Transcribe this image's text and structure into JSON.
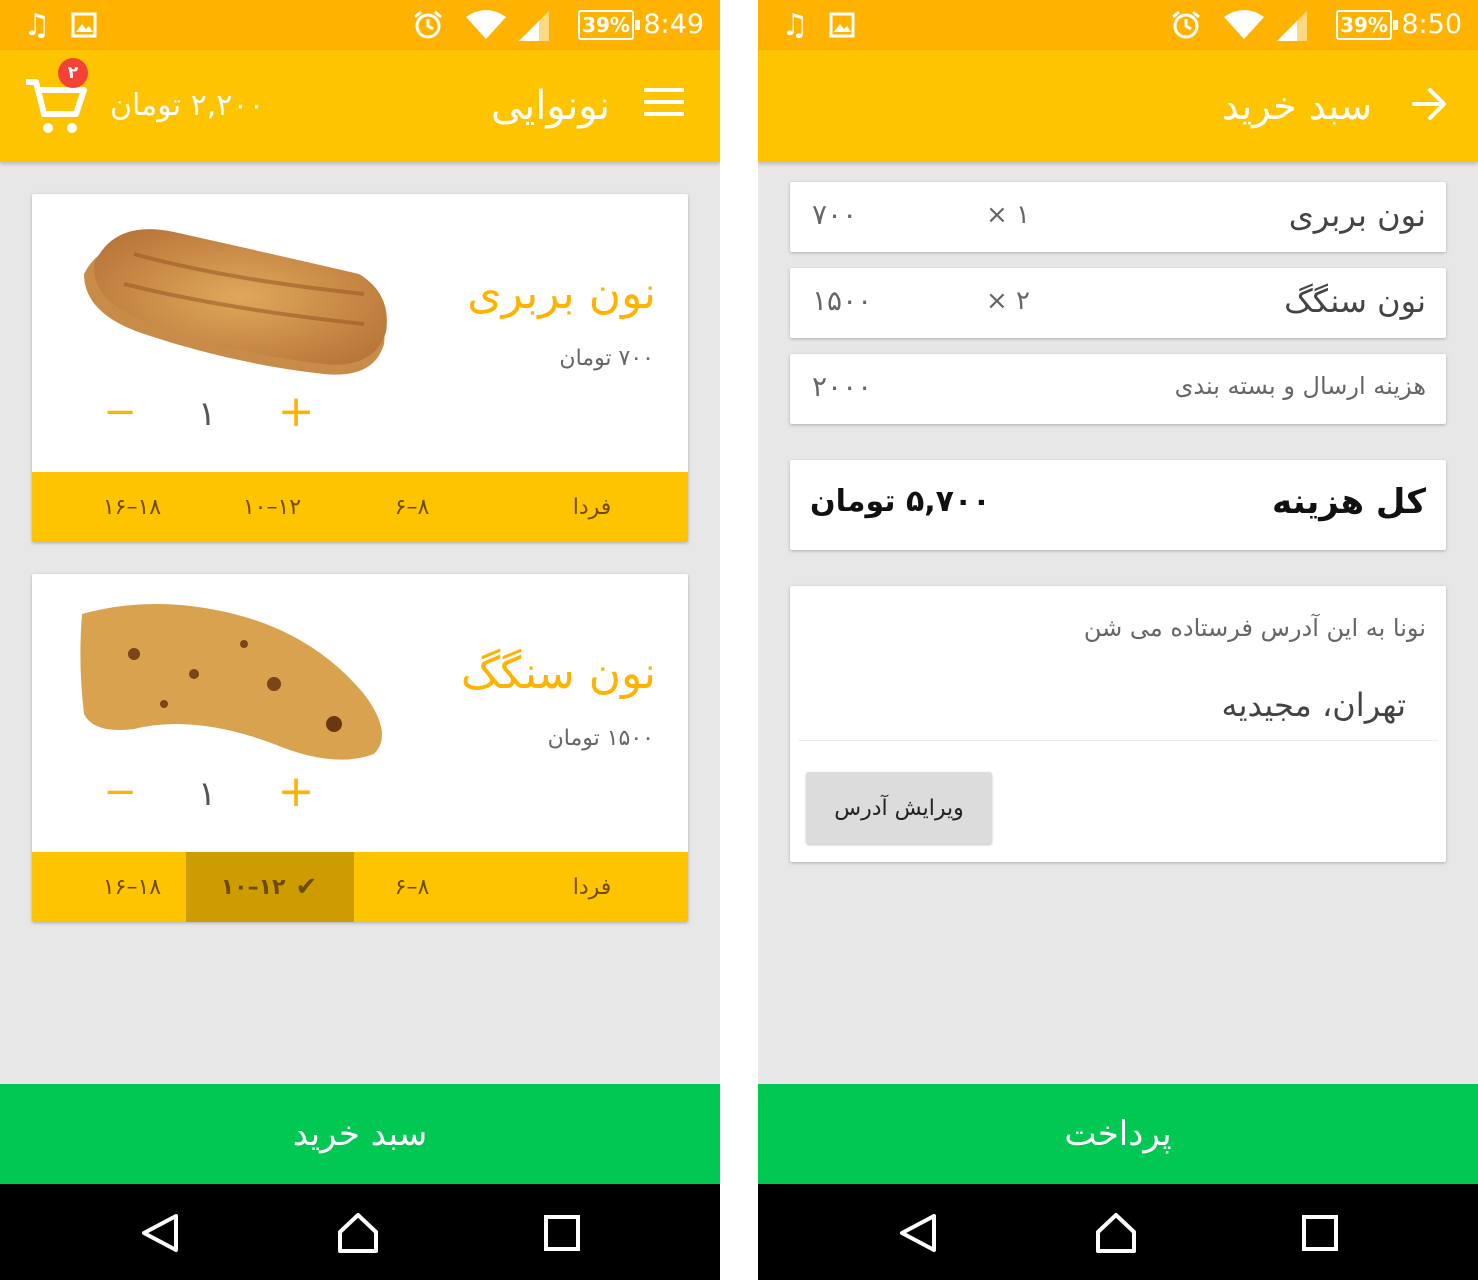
{
  "left": {
    "status": {
      "battery": "39%",
      "time": "8:49"
    },
    "appbar": {
      "title": "نونوایی",
      "cart_total": "۲,۲۰۰ تومان",
      "cart_count": "۲"
    },
    "products": [
      {
        "name": "نون بربری",
        "price": "۷۰۰ تومان",
        "quantity": "۱",
        "day_label": "فردا",
        "slots": [
          "۶–۸",
          "۱۰–۱۲",
          "۱۶–۱۸"
        ]
      },
      {
        "name": "نون سنگگ",
        "price": "۱۵۰۰ تومان",
        "quantity": "۱",
        "day_label": "فردا",
        "slots": [
          "۶–۸",
          "۱۰–۱۲",
          "۱۶–۱۸"
        ]
      }
    ],
    "bottom_button": "سبد خرید"
  },
  "right": {
    "status": {
      "battery": "39%",
      "time": "8:50"
    },
    "appbar": {
      "title": "سبد خرید"
    },
    "lines": [
      {
        "name": "نون بربری",
        "qty": "× ۱",
        "price": "۷۰۰"
      },
      {
        "name": "نون سنگگ",
        "qty": "× ۲",
        "price": "۱۵۰۰"
      },
      {
        "name": "هزینه ارسال و بسته بندی",
        "price": "۲۰۰۰"
      }
    ],
    "total": {
      "label": "کل هزینه",
      "value": "۵,۷۰۰ تومان"
    },
    "address": {
      "note": "نونا به این آدرس فرستاده می شن",
      "value": "تهران، مجیدیه",
      "edit_label": "ویرایش آدرس"
    },
    "bottom_button": "پرداخت"
  },
  "colors": {
    "status_bar": "#ffb300",
    "app_bar": "#ffc400",
    "accent": "#ffb300",
    "slot_selected": "#cc9c00",
    "primary_button": "#00c853",
    "badge": "#f44336"
  },
  "icons": [
    "music-icon",
    "image-icon",
    "alarm-icon",
    "wifi-icon",
    "signal-icon",
    "menu-icon",
    "cart-icon",
    "check-icon",
    "back-arrow-icon",
    "nav-back-icon",
    "nav-home-icon",
    "nav-recent-icon"
  ]
}
